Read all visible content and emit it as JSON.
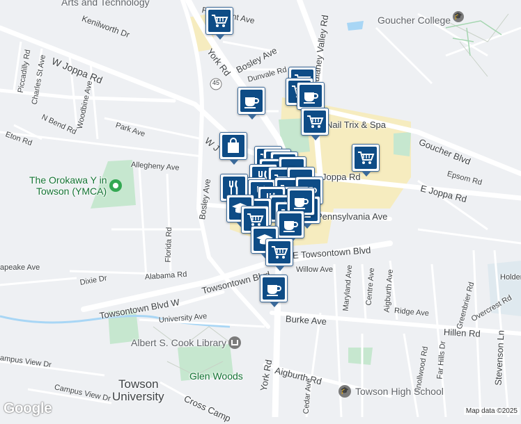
{
  "map": {
    "attribution": "Map data ©2025",
    "logo": "Google",
    "route_shield": "45",
    "labels": {
      "arts_and_technology": "Arts and Technology",
      "fairmount_ave": "Fairmount Ave",
      "kenilworth_dr": "Kenilworth Dr",
      "york_rd_north": "York Rd",
      "bosley_ave_north": "Bosley Ave",
      "dulaney_valley_rd": "Dulaney Valley Rd",
      "dunvale_rd": "Dunvale Rd",
      "goucher_college": "Goucher College",
      "w_joppa_rd_west": "W Joppa Rd",
      "piccadilly_rd": "Piccadilly Rd",
      "charles_st_ave": "Charles St Ave",
      "n_bend_rd": "N Bend Rd",
      "woodbine_ave": "Woodbine Ave",
      "park_ave": "Park Ave",
      "eton_rd": "Eton Rd",
      "w_joppa_rd_center": "W J",
      "nail_trix_spa": "Nail Trix & Spa",
      "goucher_blvd": "Goucher Blvd",
      "allegheny_ave": "Allegheny Ave",
      "orokawa_ymca_line1": "The Orokawa Y in",
      "orokawa_ymca_line2": "Towson (YMCA)",
      "joppa_rd_east": "Joppa Rd",
      "epsom_rd": "Epsom Rd",
      "e_joppa_rd": "E Joppa Rd",
      "bosley_ave_south": "Bosley Ave",
      "florida_rd": "Florida Rd",
      "pennsylvania_ave": "Pennsylvania Ave",
      "chesapeake_ave": "apeake Ave",
      "e_towsontown_blvd": "E Towsontown Blvd",
      "towsontown_blvd": "Towsontown Blvd",
      "dixie_dr": "Dixie Dr",
      "alabama_rd": "Alabama Rd",
      "willow_ave": "Willow Ave",
      "towsontown_blvd_w": "Towsontown Blvd W",
      "maryland_ave": "Maryland Ave",
      "centre_ave": "Centre Ave",
      "aigburth_ave": "Aigburth Ave",
      "greenbrier_rd": "Greenbrier Rd",
      "overcrest_rd": "Overcrest Rd",
      "holden": "Holden",
      "university_ave": "University Ave",
      "ridge_ave": "Ridge Ave",
      "burke_ave": "Burke Ave",
      "hillen_rd": "Hillen Rd",
      "albert_s_cook_library": "Albert S. Cook Library",
      "far_hills_dr": "Far Hills Dr",
      "stevenson_ln": "Stevenson Ln",
      "knollwood_rd": "Knollwood Rd",
      "campus_view_dr_1": "ampus View Dr",
      "campus_view_dr_2": "Campus View Dr",
      "glen_woods": "Glen Woods",
      "york_rd_south": "York Rd",
      "aigburth_rd": "Aigburth Rd",
      "towson_university_line1": "Towson",
      "towson_university_line2": "University",
      "cedar_ave": "Cedar Ave",
      "towson_high_school": "Towson High School",
      "cross_campus": "Cross Camp"
    }
  },
  "markers": [
    {
      "type": "grocery",
      "icon": "cart-icon"
    },
    {
      "type": "grocery",
      "icon": "cart-icon"
    },
    {
      "type": "grocery",
      "icon": "cart-icon"
    },
    {
      "type": "cafe",
      "icon": "coffee-cup-icon"
    },
    {
      "type": "cafe",
      "icon": "coffee-cup-icon"
    },
    {
      "type": "grocery",
      "icon": "cart-icon"
    },
    {
      "type": "shopping",
      "icon": "shopping-bag-icon"
    },
    {
      "type": "grocery",
      "icon": "cart-icon"
    },
    {
      "type": "restaurant",
      "icon": "fork-knife-icon"
    },
    {
      "type": "cafe",
      "icon": "coffee-cup-icon"
    },
    {
      "type": "school",
      "icon": "graduation-cap-icon"
    },
    {
      "type": "grocery",
      "icon": "cart-icon"
    },
    {
      "type": "cafe",
      "icon": "coffee-cup-icon"
    },
    {
      "type": "school",
      "icon": "graduation-cap-icon"
    },
    {
      "type": "grocery",
      "icon": "cart-icon"
    },
    {
      "type": "cafe",
      "icon": "coffee-cup-icon"
    }
  ],
  "colors": {
    "marker_fill": "#0e4c86",
    "park_green": "#c3e6cb",
    "commercial_yellow": "#f5eab7",
    "road_white": "#ffffff",
    "highway": "#d8dde4"
  }
}
